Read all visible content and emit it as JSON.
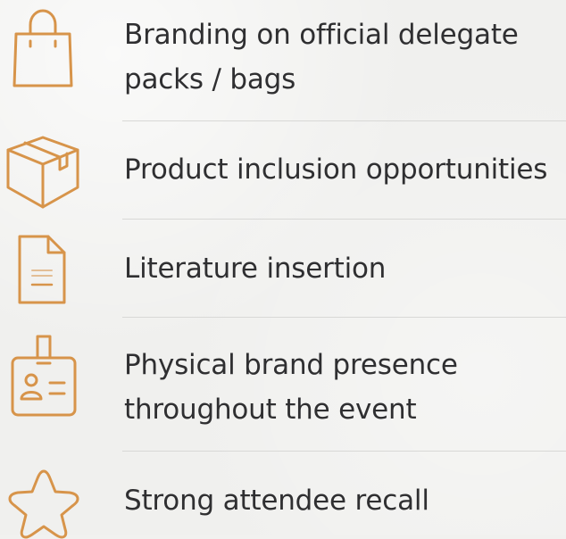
{
  "colors": {
    "background": "#f0f0ee",
    "icon": "#d7944a",
    "text": "#2f2f31",
    "divider": "#d8d8d6"
  },
  "items": [
    {
      "icon": "shopping-bag-icon",
      "lines": [
        "Branding on official delegate",
        "packs / bags"
      ]
    },
    {
      "icon": "box-icon",
      "lines": [
        "Product inclusion opportunities"
      ]
    },
    {
      "icon": "document-icon",
      "lines": [
        "Literature insertion"
      ]
    },
    {
      "icon": "badge-icon",
      "lines": [
        "Physical brand presence",
        "throughout the event"
      ]
    },
    {
      "icon": "star-icon",
      "lines": [
        "Strong attendee recall"
      ]
    }
  ]
}
